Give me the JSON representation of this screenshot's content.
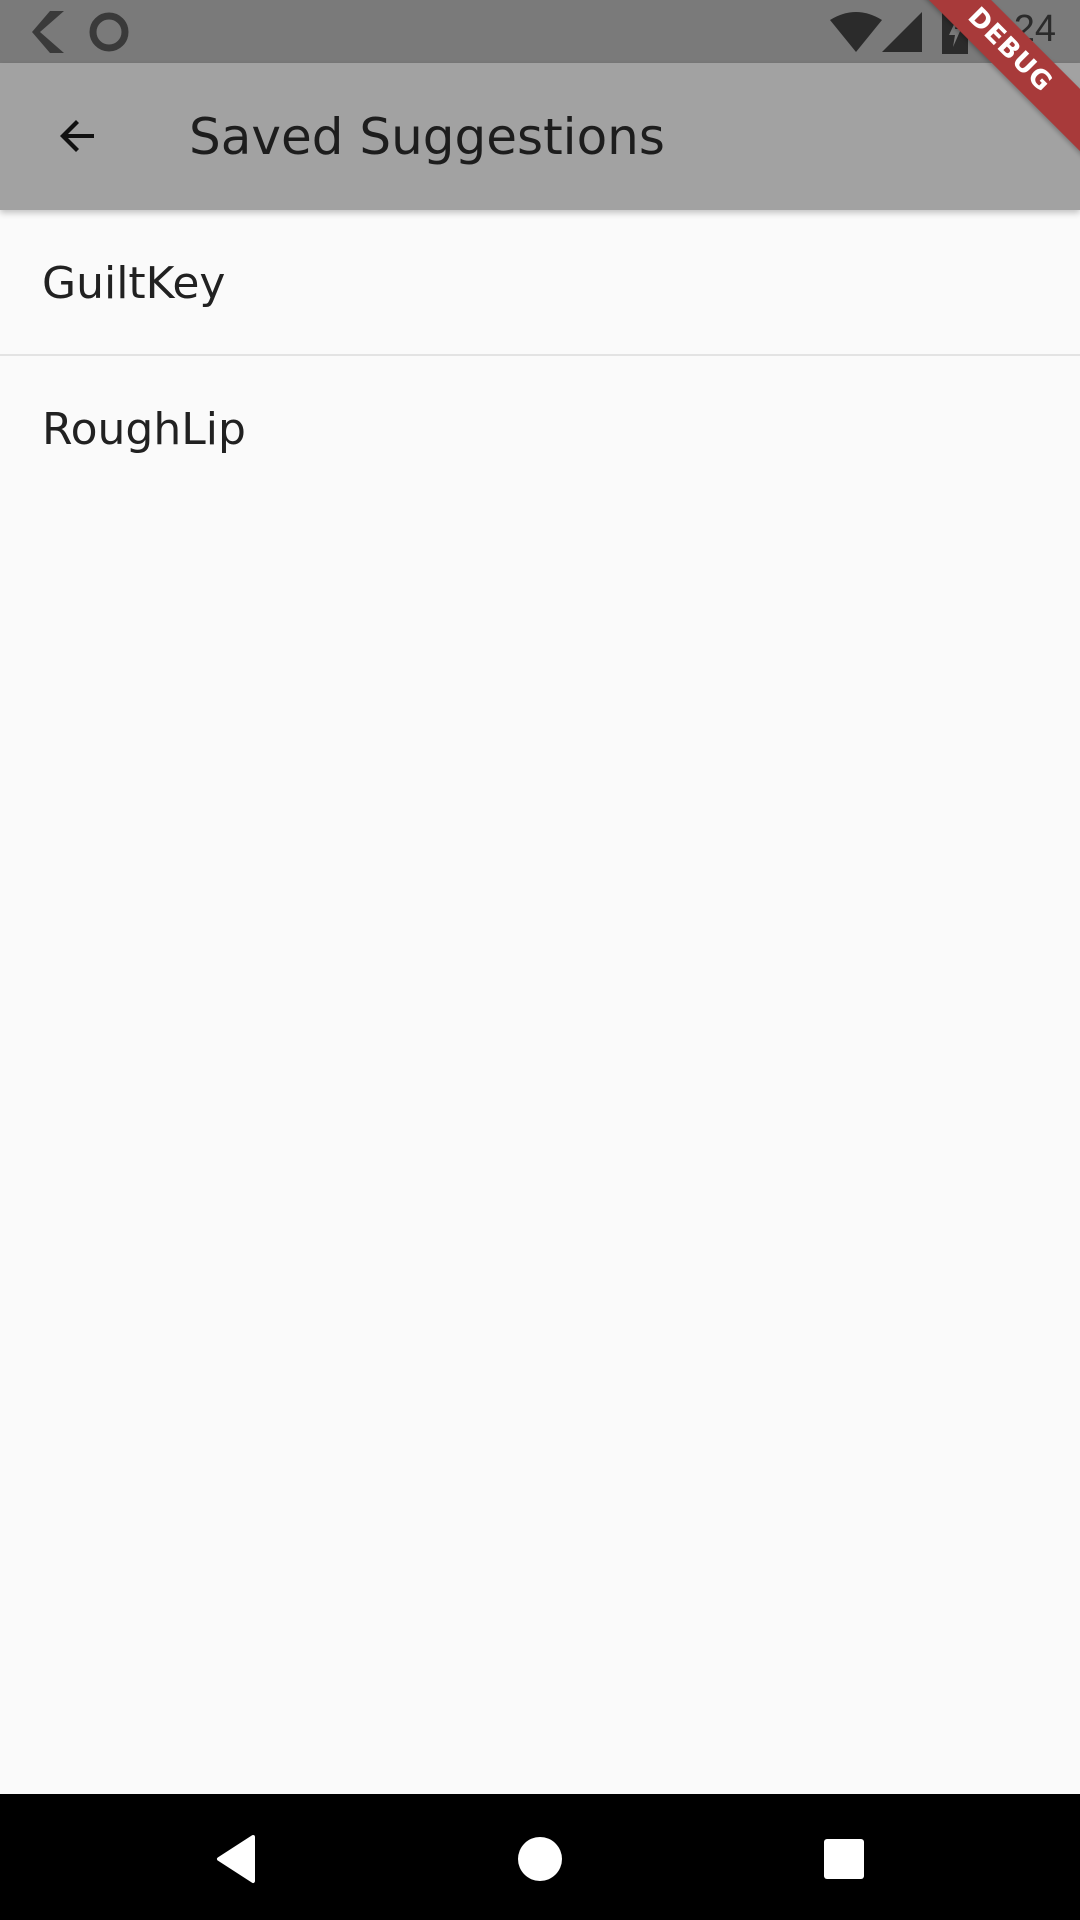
{
  "status_bar": {
    "time": "8:24",
    "icons": [
      "flutter-icon",
      "record-icon",
      "wifi-icon",
      "signal-icon",
      "battery-charging-icon"
    ]
  },
  "app_bar": {
    "title": "Saved Suggestions",
    "back_icon": "arrow-back-icon",
    "color": "#a2a2a2"
  },
  "debug_banner": {
    "label": "DEBUG",
    "color": "#a83a3a"
  },
  "list": {
    "items": [
      {
        "label": "GuiltKey"
      },
      {
        "label": "RoughLip"
      }
    ]
  },
  "nav_bar": {
    "icons": [
      "back-triangle-icon",
      "home-circle-icon",
      "recents-square-icon"
    ]
  }
}
